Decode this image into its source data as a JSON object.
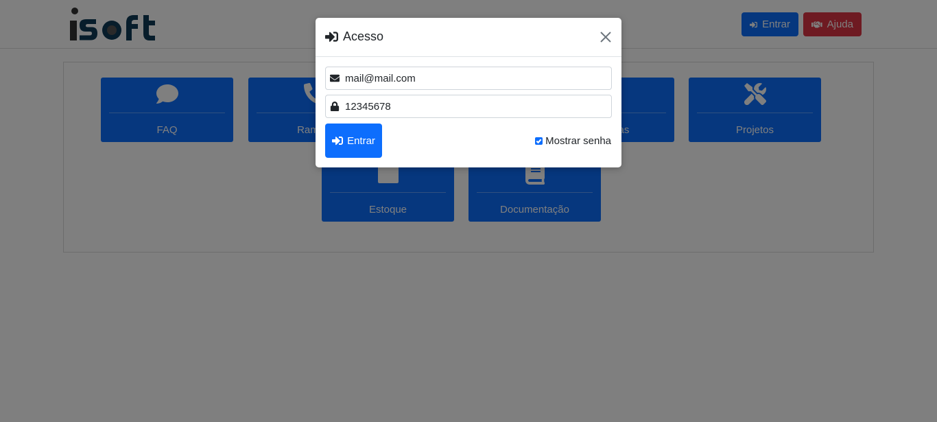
{
  "header": {
    "logo_text": "isoft",
    "entrar_label": "Entrar",
    "ajuda_label": "Ajuda",
    "colors": {
      "primary": "#0d6efd",
      "danger": "#dc3545",
      "logo_dark": "#0f3b57",
      "logo_gray": "#333333"
    }
  },
  "cards": [
    {
      "label": "FAQ",
      "icon": "comment-icon"
    },
    {
      "label": "Ramais",
      "icon": "phone-icon"
    },
    {
      "label": "Sistemas",
      "icon": "desktop-icon"
    },
    {
      "label": "Projetos",
      "icon": "tools-icon"
    },
    {
      "label": "Estoque",
      "icon": "box-icon"
    },
    {
      "label": "Documentação",
      "icon": "book-icon"
    }
  ],
  "modal": {
    "title": "Acesso",
    "title_icon": "sign-in-icon",
    "email_value": "mail@mail.com",
    "password_value": "12345678",
    "submit_label": "Entrar",
    "show_password_label": "Mostrar senha",
    "show_password_checked": true
  }
}
